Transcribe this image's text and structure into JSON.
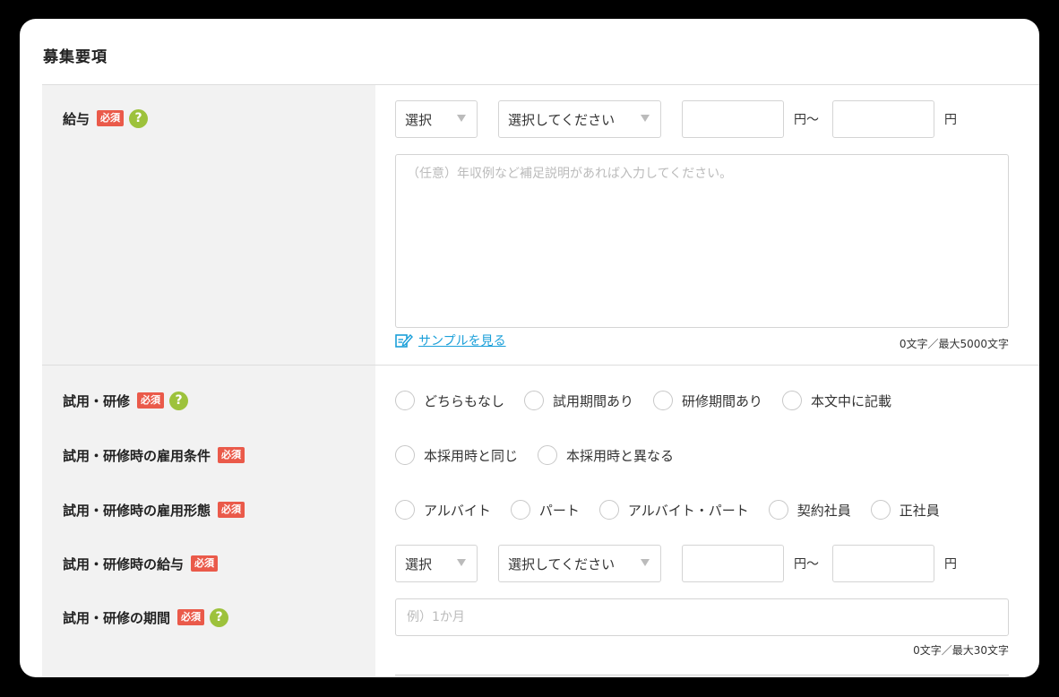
{
  "section": {
    "title": "募集要項"
  },
  "badges": {
    "required": "必須",
    "help": "?"
  },
  "salary": {
    "label": "給与",
    "select1": "選択",
    "select2": "選択してください",
    "unit_from": "円〜",
    "unit_to": "円",
    "note_placeholder": "（任意）年収例など補足説明があれば入力してください。",
    "sample_link": "サンプルを見る",
    "counter": "0文字／最大5000文字"
  },
  "trial": {
    "label": "試用・研修",
    "options": [
      "どちらもなし",
      "試用期間あり",
      "研修期間あり",
      "本文中に記載"
    ]
  },
  "trial_conditions": {
    "label": "試用・研修時の雇用条件",
    "options": [
      "本採用時と同じ",
      "本採用時と異なる"
    ]
  },
  "trial_type": {
    "label": "試用・研修時の雇用形態",
    "options": [
      "アルバイト",
      "パート",
      "アルバイト・パート",
      "契約社員",
      "正社員"
    ]
  },
  "trial_salary": {
    "label": "試用・研修時の給与",
    "select1": "選択",
    "select2": "選択してください",
    "unit_from": "円〜",
    "unit_to": "円"
  },
  "trial_period": {
    "label": "試用・研修の期間",
    "placeholder": "例）1か月",
    "counter": "0文字／最大30文字"
  }
}
